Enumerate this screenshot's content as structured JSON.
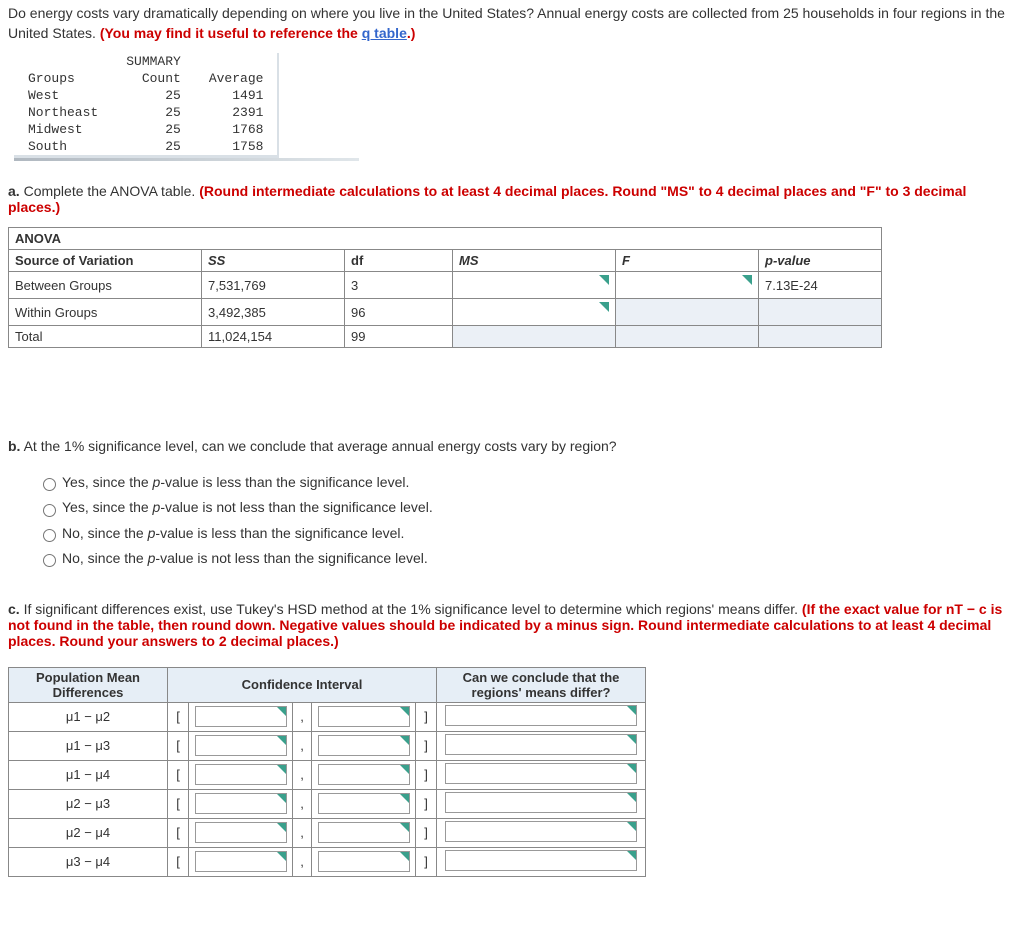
{
  "intro": {
    "text1": "Do energy costs vary dramatically depending on where you live in the United States? Annual energy costs are collected from 25 households in four regions in the United States. ",
    "redtext": "(You may find it useful to reference the ",
    "linktext": "q table",
    "after_link": ".)"
  },
  "summary": {
    "title": "SUMMARY",
    "headers": {
      "c1": "Groups",
      "c2": "Count",
      "c3": "Average"
    },
    "rows": [
      {
        "g": "West",
        "n": "25",
        "avg": "1491"
      },
      {
        "g": "Northeast",
        "n": "25",
        "avg": "2391"
      },
      {
        "g": "Midwest",
        "n": "25",
        "avg": "1768"
      },
      {
        "g": "South",
        "n": "25",
        "avg": "1758"
      }
    ]
  },
  "partA": {
    "label": "a.",
    "text": " Complete the ANOVA table. ",
    "red": "(Round intermediate calculations to at least 4 decimal places. Round \"MS\" to 4 decimal places and \"F\" to 3 decimal places.)"
  },
  "anova": {
    "title": "ANOVA",
    "headers": {
      "sov": "Source of Variation",
      "ss": "SS",
      "df": "df",
      "ms": "MS",
      "f": "F",
      "p": "p-value"
    },
    "rows": {
      "between": {
        "label": "Between Groups",
        "ss": "7,531,769",
        "df": "3",
        "p": "7.13E-24"
      },
      "within": {
        "label": "Within Groups",
        "ss": "3,492,385",
        "df": "96"
      },
      "total": {
        "label": "Total",
        "ss": "11,024,154",
        "df": "99"
      }
    }
  },
  "partB": {
    "label": "b.",
    "text": " At the 1% significance level, can we conclude that average annual energy costs vary by region?",
    "options": [
      "Yes, since the p-value is less than the significance level.",
      "Yes, since the p-value is not less than the significance level.",
      "No, since the p-value is less than the significance level.",
      "No, since the p-value is not less than the significance level."
    ]
  },
  "partC": {
    "label": "c.",
    "text": " If significant differences exist, use Tukey's HSD method at the 1% significance level to determine which regions' means differ. ",
    "red": "(If the exact value for nT − c is not found in the table, then round down. Negative values should be indicated by a minus sign. Round intermediate calculations to at least 4 decimal places. Round your answers to 2 decimal places.)"
  },
  "tukey": {
    "headers": {
      "pmd": "Population Mean Differences",
      "ci": "Confidence Interval",
      "conc": "Can we conclude that the regions' means differ?"
    },
    "rows": [
      "μ1 − μ2",
      "μ1 − μ3",
      "μ1 − μ4",
      "μ2 − μ3",
      "μ2 − μ4",
      "μ3 − μ4"
    ],
    "punct": {
      "lb": "[",
      "comma": ",",
      "rb": "]"
    }
  }
}
